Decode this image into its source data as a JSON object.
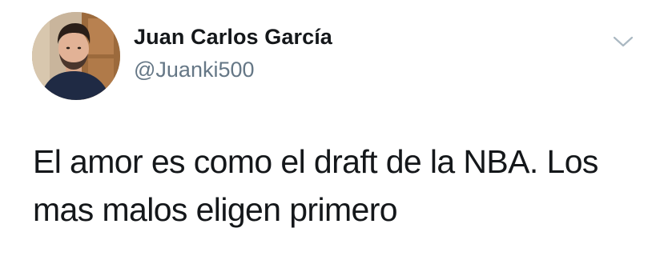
{
  "tweet": {
    "author": {
      "display_name": "Juan Carlos García",
      "handle": "@Juanki500"
    },
    "text": "El amor es como el draft de la NBA. Los mas malos eligen primero",
    "menu_icon": "chevron-down-icon",
    "avatar_icon": "avatar"
  },
  "colors": {
    "text": "#14171a",
    "secondary": "#657786",
    "caret": "#aab8c2",
    "background": "#ffffff"
  }
}
